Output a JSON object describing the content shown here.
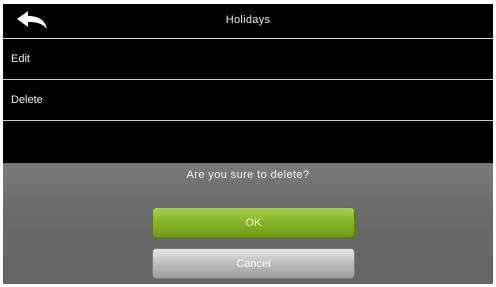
{
  "header": {
    "title": "Holidays",
    "back_icon": "back-arrow-icon"
  },
  "menu": {
    "items": [
      {
        "label": "Edit"
      },
      {
        "label": "Delete"
      }
    ]
  },
  "dialog": {
    "message": "Are you sure to delete?",
    "ok_label": "OK",
    "cancel_label": "Cancel"
  },
  "colors": {
    "background": "#000000",
    "dialog": "#6e6e6e",
    "ok_button": "#86b427",
    "cancel_button": "#bdbdbd"
  }
}
